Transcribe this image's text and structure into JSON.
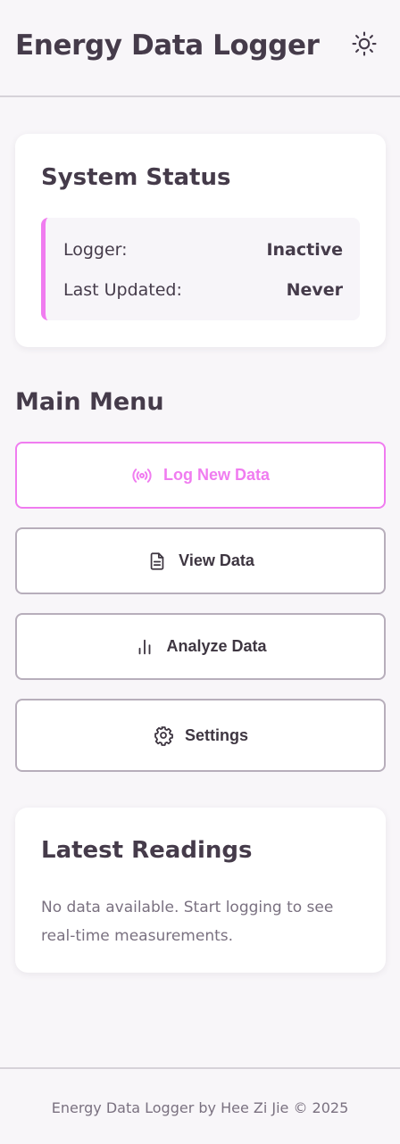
{
  "header": {
    "title": "Energy Data Logger",
    "theme_icon": "sun-icon"
  },
  "system_status": {
    "title": "System Status",
    "accent_color": "#f07cf0",
    "rows": [
      {
        "label": "Logger:",
        "value": "Inactive"
      },
      {
        "label": "Last Updated:",
        "value": "Never"
      }
    ]
  },
  "main_menu": {
    "title": "Main Menu",
    "items": [
      {
        "label": "Log New Data",
        "icon": "broadcast-icon",
        "active": true
      },
      {
        "label": "View Data",
        "icon": "document-icon",
        "active": false
      },
      {
        "label": "Analyze Data",
        "icon": "bar-chart-icon",
        "active": false
      },
      {
        "label": "Settings",
        "icon": "gear-icon",
        "active": false
      }
    ]
  },
  "latest_readings": {
    "title": "Latest Readings",
    "message": "No data available. Start logging to see real-time measurements."
  },
  "footer": {
    "text": "Energy Data Logger by Hee Zi Jie © 2025"
  },
  "colors": {
    "accent": "#f07cf0",
    "text": "#453b4a",
    "muted_text": "#7a7180",
    "background": "#f8f6f9",
    "button_border": "#b7aebb"
  }
}
